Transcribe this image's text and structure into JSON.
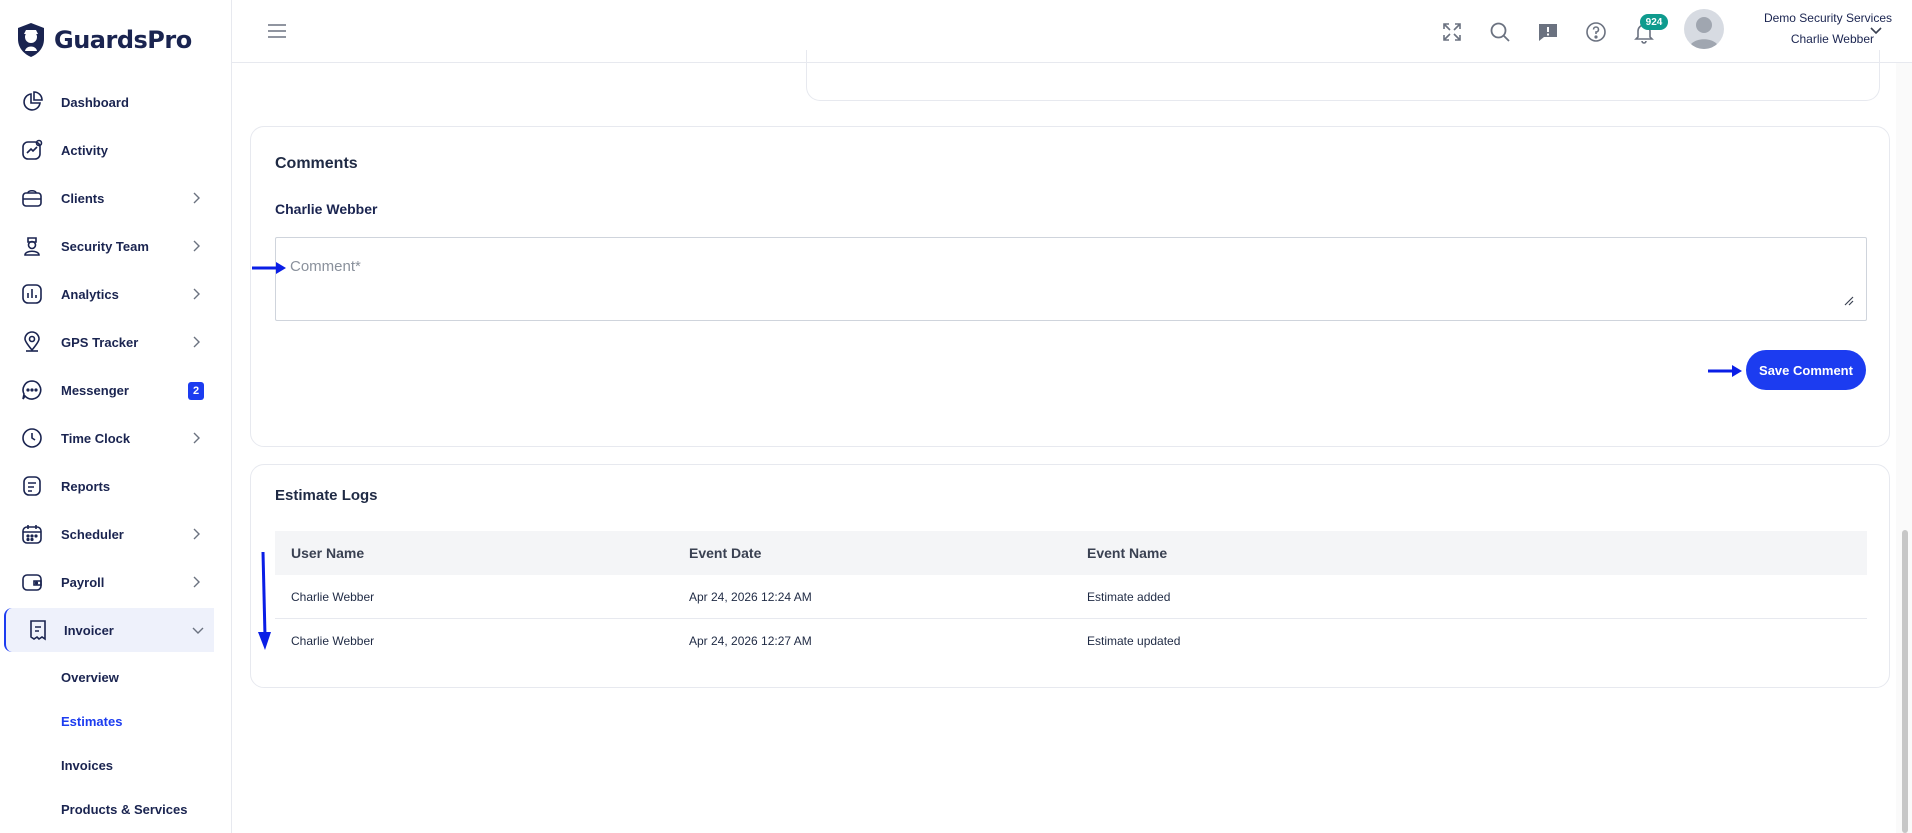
{
  "brand": {
    "name": "GuardsPro"
  },
  "sidebar": {
    "items": [
      {
        "label": "Dashboard"
      },
      {
        "label": "Activity"
      },
      {
        "label": "Clients"
      },
      {
        "label": "Security Team"
      },
      {
        "label": "Analytics"
      },
      {
        "label": "GPS Tracker"
      },
      {
        "label": "Messenger",
        "badge": "2"
      },
      {
        "label": "Time Clock"
      },
      {
        "label": "Reports"
      },
      {
        "label": "Scheduler"
      },
      {
        "label": "Payroll"
      },
      {
        "label": "Invoicer"
      }
    ],
    "subitems": [
      {
        "label": "Overview"
      },
      {
        "label": "Estimates"
      },
      {
        "label": "Invoices"
      },
      {
        "label": "Products & Services"
      }
    ]
  },
  "header": {
    "notification_count": "924",
    "company": "Demo Security Services",
    "user": "Charlie Webber"
  },
  "comments": {
    "title": "Comments",
    "commenter": "Charlie Webber",
    "placeholder": "Comment*",
    "value": "",
    "save_label": "Save Comment"
  },
  "logs": {
    "title": "Estimate Logs",
    "columns": [
      "User Name",
      "Event Date",
      "Event Name"
    ],
    "rows": [
      [
        "Charlie Webber",
        "Apr 24, 2026 12:24 AM",
        "Estimate added"
      ],
      [
        "Charlie Webber",
        "Apr 24, 2026 12:27 AM",
        "Estimate updated"
      ]
    ]
  },
  "colors": {
    "accent": "#1c3cf0",
    "notification": "#0f9b8e",
    "annotation": "#0a1ee6"
  }
}
